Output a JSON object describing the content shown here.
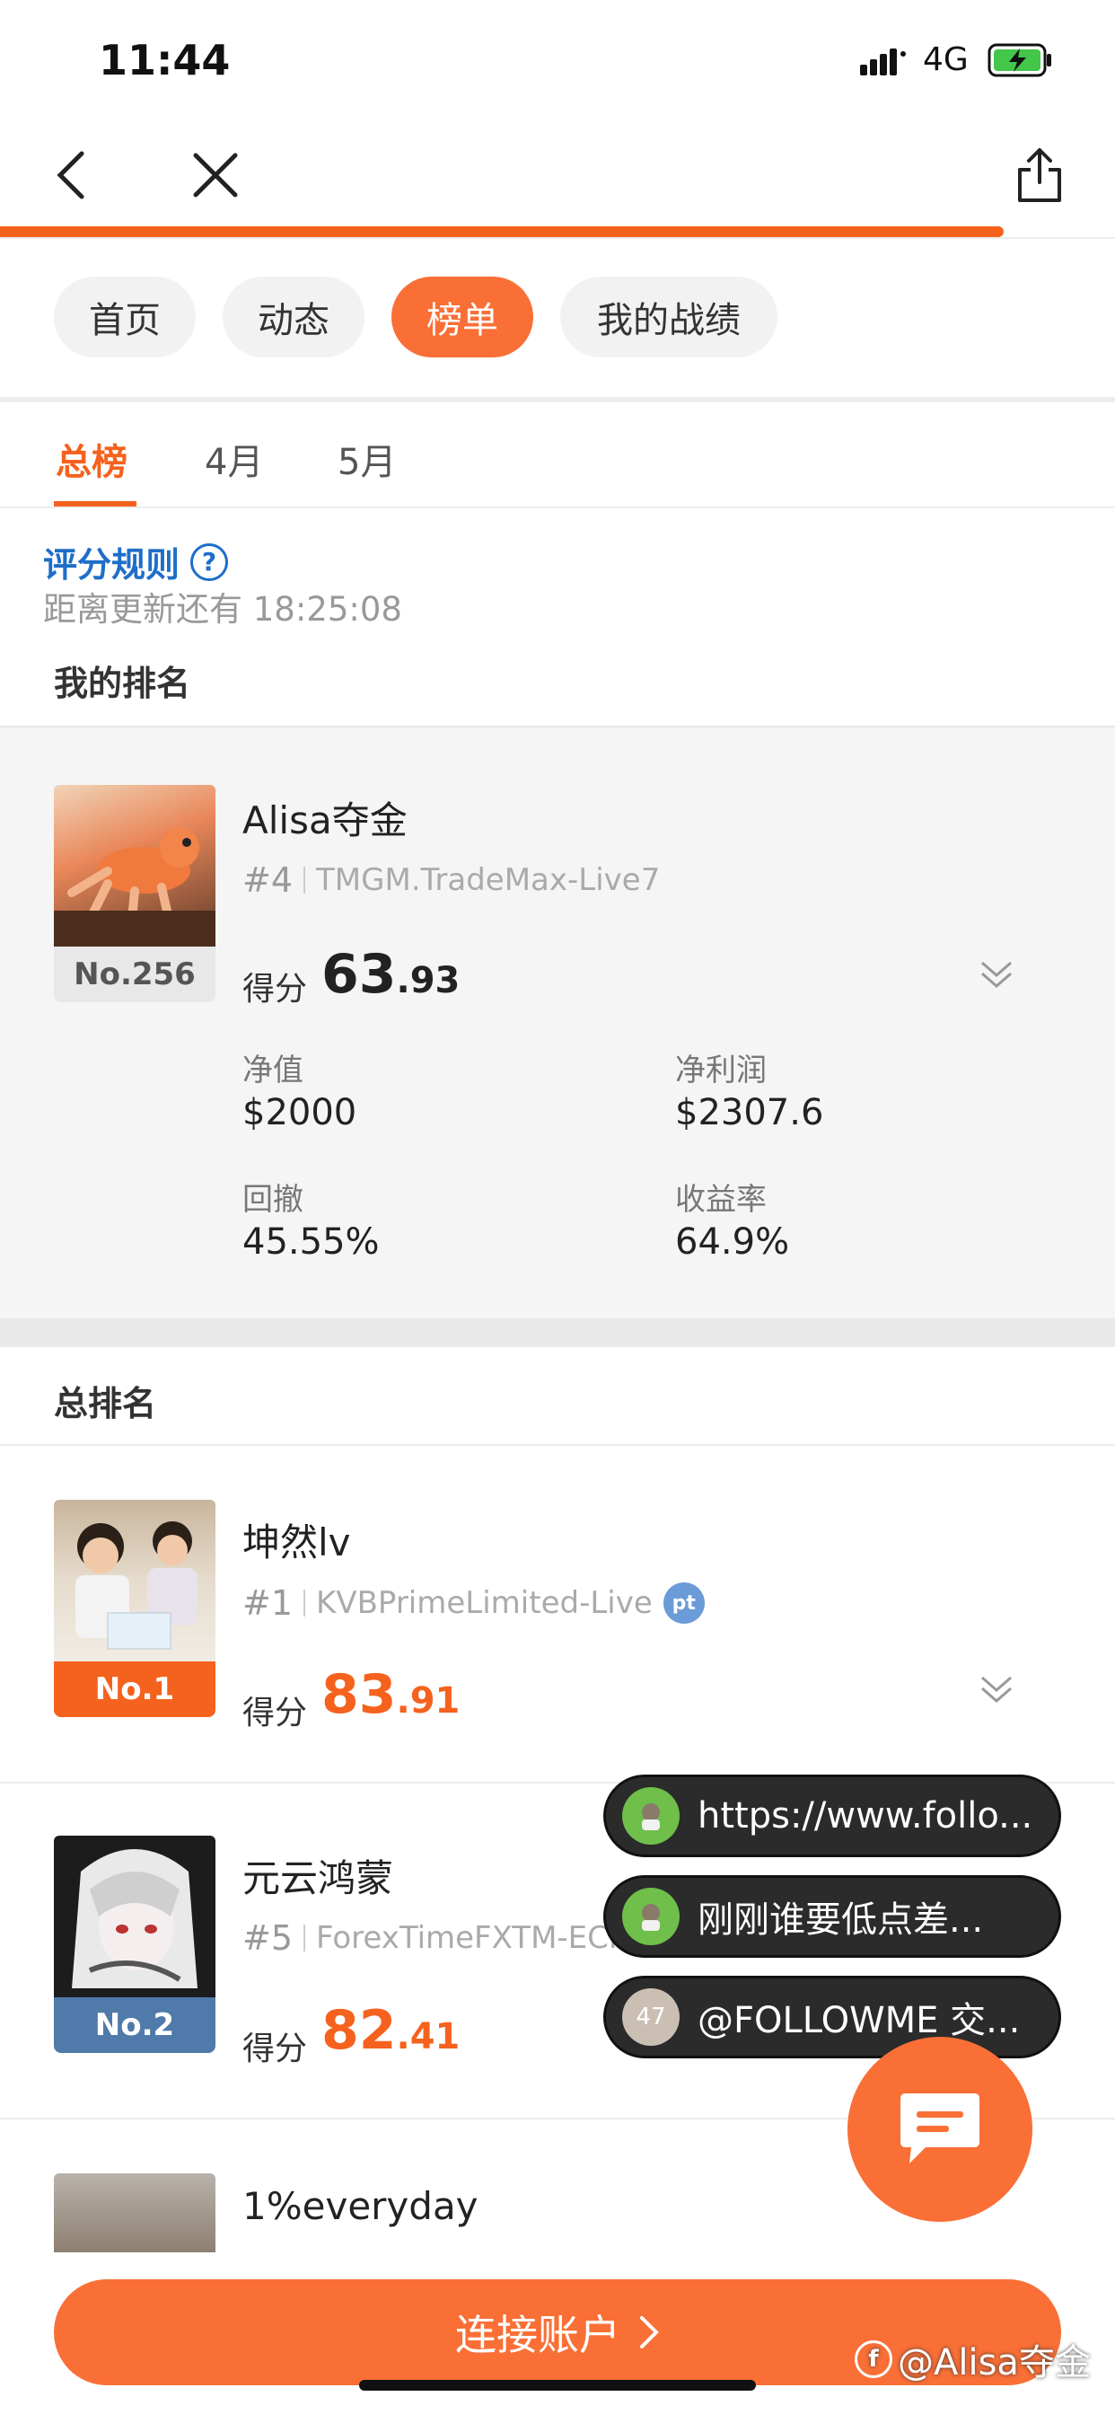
{
  "status_bar": {
    "time": "11:44",
    "network": "4G"
  },
  "nav": {
    "back_icon": "back-arrow-icon",
    "close_icon": "close-icon",
    "share_icon": "share-icon",
    "load_progress": 0.9
  },
  "top_tabs": [
    {
      "label": "首页",
      "active": false
    },
    {
      "label": "动态",
      "active": false
    },
    {
      "label": "榜单",
      "active": true
    },
    {
      "label": "我的战绩",
      "active": false
    }
  ],
  "sub_tabs": [
    {
      "label": "总榜",
      "active": true
    },
    {
      "label": "4月",
      "active": false
    },
    {
      "label": "5月",
      "active": false
    }
  ],
  "rules": {
    "label": "评分规则",
    "icon": "question-icon",
    "countdown_prefix": "距离更新还有",
    "countdown": "18:25:08"
  },
  "my_rank": {
    "section_title": "我的排名",
    "rank_tag": "No.256",
    "name": "Alisa夺金",
    "rank": "#4",
    "broker": "TMGM.TradeMax-Live7",
    "score_label": "得分",
    "score_int": "63",
    "score_dec": ".93",
    "stats": [
      {
        "label": "净值",
        "value": "$2000"
      },
      {
        "label": "净利润",
        "value": "$2307.6"
      },
      {
        "label": "回撤",
        "value": "45.55%"
      },
      {
        "label": "收益率",
        "value": "64.9%"
      }
    ]
  },
  "overall": {
    "section_title": "总排名",
    "entries": [
      {
        "rank_tag": "No.1",
        "name": "坤然lv",
        "rank": "#1",
        "broker": "KVBPrimeLimited-Live",
        "badge": "pt",
        "score_label": "得分",
        "score_int": "83",
        "score_dec": ".91"
      },
      {
        "rank_tag": "No.2",
        "name": "元云鸿蒙",
        "rank": "#5",
        "broker": "ForexTimeFXTM-ECN",
        "score_label": "得分",
        "score_int": "82",
        "score_dec": ".41"
      },
      {
        "name": "1%everyday"
      }
    ]
  },
  "floating_messages": [
    {
      "text": "https://www.follo...",
      "avatar": "green"
    },
    {
      "text": "刚刚谁要低点差...",
      "avatar": "green"
    },
    {
      "text": "@FOLLOWME 交...",
      "avatar": "47"
    }
  ],
  "chat_fab_icon": "chat-bubble-icon",
  "connect_button": {
    "label": "连接账户"
  },
  "watermark": {
    "text": "@Alisa夺金",
    "logo": "f"
  },
  "colors": {
    "accent": "#f96f36",
    "link": "#1e6ec8",
    "silver_tag": "#4f7aaa"
  }
}
